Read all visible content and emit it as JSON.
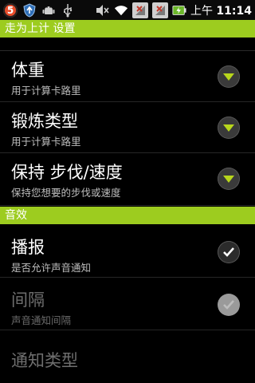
{
  "status_bar": {
    "notification_count": "5",
    "icons_left": [
      "notification-badge-icon",
      "shield-icon",
      "android-icon",
      "usb-icon"
    ],
    "icons_right": [
      "mute-icon",
      "wifi-icon",
      "no-signal-icon",
      "no-signal-icon",
      "battery-charging-icon"
    ],
    "time_period": "上午",
    "time": "11:14"
  },
  "title_bar": {
    "label": "走为上计 设置"
  },
  "preferences_top": [
    {
      "title": "体重",
      "summary": "用于计算卡路里",
      "control": "dropdown"
    },
    {
      "title": "锻炼类型",
      "summary": "用于计算卡路里",
      "control": "dropdown"
    },
    {
      "title": "保持 步伐/速度",
      "summary": "保持您想要的步伐或速度",
      "control": "dropdown"
    }
  ],
  "category_sound": {
    "label": "音效"
  },
  "preferences_sound": [
    {
      "title": "播报",
      "summary": "是否允许声音通知",
      "control": "checkbox",
      "checked": true,
      "enabled": true
    },
    {
      "title": "间隔",
      "summary": "声音通知间隔",
      "control": "checkbox",
      "checked": true,
      "enabled": false
    },
    {
      "title": "通知类型",
      "summary": "",
      "enabled": false
    }
  ],
  "colors": {
    "accent": "#9dcc1f",
    "dropdown_arrow": "#b8d61c"
  }
}
